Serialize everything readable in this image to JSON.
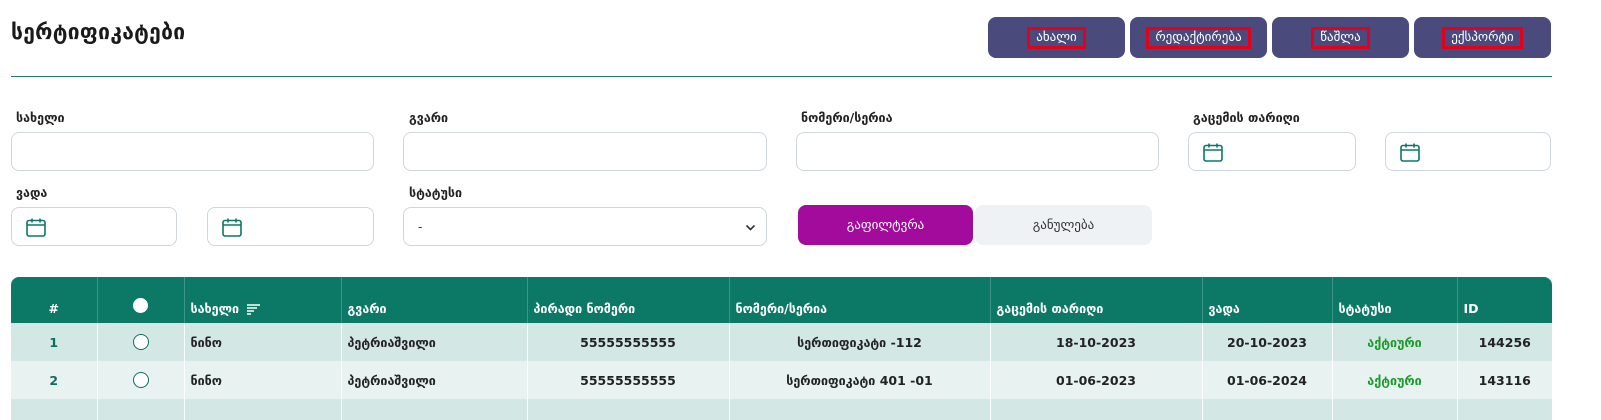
{
  "page": {
    "title": "სერტიფიკატები"
  },
  "toolbar": {
    "new_label": "ახალი",
    "edit_label": "რედაქტირება",
    "delete_label": "წაშლა",
    "export_label": "ექსპორტი"
  },
  "filters": {
    "first_name_label": "სახელი",
    "first_name_value": "",
    "last_name_label": "გვარი",
    "last_name_value": "",
    "number_label": "ნომერი/სერია",
    "number_value": "",
    "issue_date_label": "გაცემის თარიღი",
    "expiry_label": "ვადა",
    "status_label": "სტატუსი",
    "status_selected": "-",
    "filter_button": "გაფილტვრა",
    "reset_button": "განულება"
  },
  "table": {
    "columns": [
      "#",
      "",
      "სახელი",
      "გვარი",
      "პირადი ნომერი",
      "ნომერი/სერია",
      "გაცემის თარიღი",
      "ვადა",
      "სტატუსი",
      "ID"
    ],
    "rows": [
      {
        "num": "1",
        "first_name": "ნინო",
        "last_name": "პეტრიაშვილი",
        "personal_no": "55555555555",
        "cert_no": "სერთიფიკატი -112",
        "issue_date": "18-10-2023",
        "expiry": "20-10-2023",
        "status": "აქტიური",
        "id": "144256"
      },
      {
        "num": "2",
        "first_name": "ნინო",
        "last_name": "პეტრიაშვილი",
        "personal_no": "55555555555",
        "cert_no": "სერთიფიკატი 401 -01",
        "issue_date": "01-06-2023",
        "expiry": "01-06-2024",
        "status": "აქტიური",
        "id": "143116"
      }
    ]
  },
  "colors": {
    "toolbar_button": "#4a4a7c",
    "accent_teal": "#0c7866",
    "filter_button": "#a20b9b",
    "status_active": "#1b9a2b",
    "highlight_outline": "#e3001b"
  }
}
